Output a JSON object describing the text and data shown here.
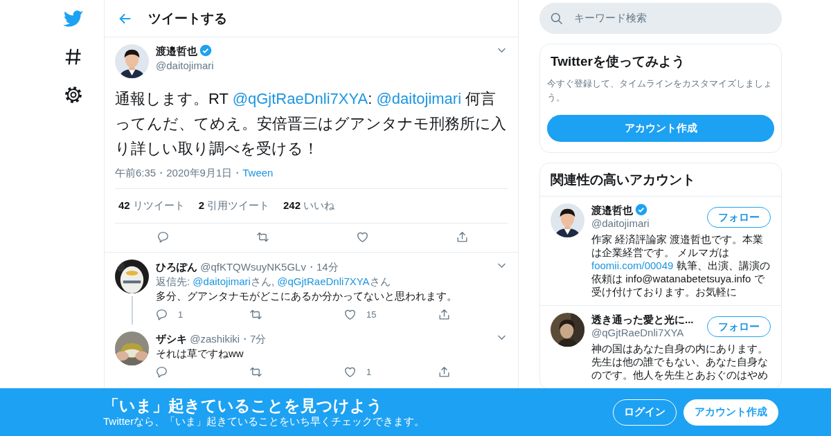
{
  "header": {
    "title": "ツイートする"
  },
  "tweet": {
    "avatar": {
      "kind": "picture"
    },
    "name": "渡邉哲也",
    "verified": true,
    "handle": "@daitojimari",
    "text": [
      {
        "text": "通報します。RT "
      },
      {
        "text": "@qGjtRaeDnli7XYA",
        "kind": "link"
      },
      {
        "text": ": "
      },
      {
        "text": "@daitojimari",
        "kind": "link"
      },
      {
        "text": " 何言ってんだ、てめえ。安倍晋三はグアンタナモ刑務所に入り詳しい取り調べを受ける！"
      }
    ],
    "meta": [
      {
        "text": "午前6:35・2020年9月1日・"
      },
      {
        "text": "Tween",
        "kind": "link"
      }
    ],
    "stats": [
      {
        "count": "42",
        "label": "リツイート"
      },
      {
        "count": "2",
        "label": "引用ツイート"
      },
      {
        "count": "242",
        "label": "いいね"
      }
    ],
    "actions": [
      {
        "kind": "reply"
      },
      {
        "kind": "retweet"
      },
      {
        "kind": "like"
      },
      {
        "kind": "share"
      }
    ]
  },
  "replies": [
    {
      "avatar": {
        "kind": "picture"
      },
      "name": "ひろぽん",
      "verified": false,
      "meta": "@qfKTQWsuyNK5GLv・14分",
      "thread_line": true,
      "reply_to": [
        {
          "text": "返信先: "
        },
        {
          "text": "@daitojimari",
          "kind": "link"
        },
        {
          "text": "さん, "
        },
        {
          "text": "@qGjtRaeDnli7XYA",
          "kind": "link"
        },
        {
          "text": "さん"
        }
      ],
      "text": "多分、グアンタナモがどこにあるか分かってないと思われます。",
      "actions": [
        {
          "kind": "reply",
          "count": "1"
        },
        {
          "kind": "retweet"
        },
        {
          "kind": "like",
          "count": "15"
        },
        {
          "kind": "share"
        }
      ]
    },
    {
      "avatar": {
        "kind": "picture"
      },
      "name": "ザシキ",
      "verified": false,
      "meta": "@zashikiki・7分",
      "thread_line": false,
      "text": "それは草ですねww",
      "actions": [
        {
          "kind": "reply"
        },
        {
          "kind": "retweet"
        },
        {
          "kind": "like",
          "count": "1"
        },
        {
          "kind": "share"
        }
      ]
    }
  ],
  "search": {
    "placeholder": "キーワード検索"
  },
  "signup_card": {
    "title": "Twitterを使ってみよう",
    "description": "今すぐ登録して、タイムラインをカスタマイズしましょう。",
    "button": "アカウント作成"
  },
  "accounts": {
    "title": "関連性の高いアカウント",
    "items": [
      {
        "avatar": {
          "kind": "picture"
        },
        "name": "渡邉哲也",
        "verified": true,
        "handle": "@daitojimari",
        "follow": "フォロー",
        "bio": [
          {
            "text": "作家 経済評論家 渡邉哲也です。本業は企業経営です。 メルマガは "
          },
          {
            "text": "foomii.com/00049",
            "kind": "link"
          },
          {
            "text": " 執筆、出演、講演の依頼は info@watanabetetsuya.info で受け付けております。お気軽に"
          }
        ]
      },
      {
        "avatar": {
          "kind": "picture"
        },
        "name": "透き通った愛と光に...",
        "verified": false,
        "handle": "@qGjtRaeDnli7XYA",
        "follow": "フォロー",
        "bio": [
          {
            "text": "神の国はあなた自身の内にあります。先生は他の誰でもない、あなた自身なのです。他人を先生とあおぐのはやめ"
          }
        ]
      }
    ]
  },
  "banner": {
    "title": "「いま」起きていることを見つけよう",
    "subtitle": "Twitterなら、「いま」起きていることをいち早くチェックできます。",
    "login": "ログイン",
    "signup": "アカウント作成"
  }
}
